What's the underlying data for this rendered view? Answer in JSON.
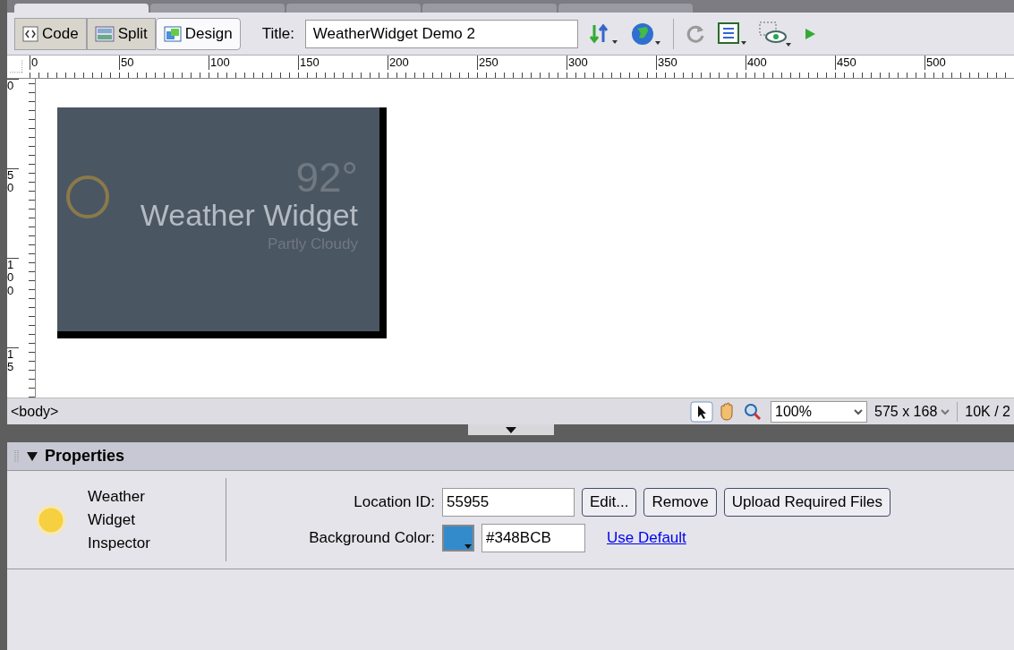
{
  "document_tabs": [
    {
      "selected": true
    },
    {
      "selected": false
    },
    {
      "selected": false
    },
    {
      "selected": false
    },
    {
      "selected": false
    }
  ],
  "toolbar": {
    "view_buttons": [
      {
        "label": "Code",
        "kind": "code",
        "selected": false
      },
      {
        "label": "Split",
        "kind": "split",
        "selected": false
      },
      {
        "label": "Design",
        "kind": "design",
        "selected": true
      }
    ],
    "title_label": "Title:",
    "title_value": "WeatherWidget Demo 2"
  },
  "ruler": {
    "horizontal": [
      "0",
      "50",
      "100",
      "150",
      "200",
      "250",
      "300",
      "350",
      "400",
      "450",
      "500"
    ],
    "vertical": [
      "0",
      "50",
      "100",
      "15"
    ]
  },
  "widget_preview": {
    "temperature": "92°",
    "title": "Weather Widget",
    "condition": "Partly Cloudy"
  },
  "status_bar": {
    "tag": "<body>",
    "zoom": "100%",
    "size": "575 x 168",
    "download": "10K / 2"
  },
  "properties": {
    "header": "Properties",
    "expanded": true,
    "inspector_name": "Weather Widget Inspector",
    "location_label": "Location ID:",
    "location_value": "55955",
    "buttons": [
      "Edit...",
      "Remove",
      "Upload Required Files"
    ],
    "bg_label": "Background Color:",
    "bg_value": "#348BCB",
    "link": "Use Default"
  }
}
